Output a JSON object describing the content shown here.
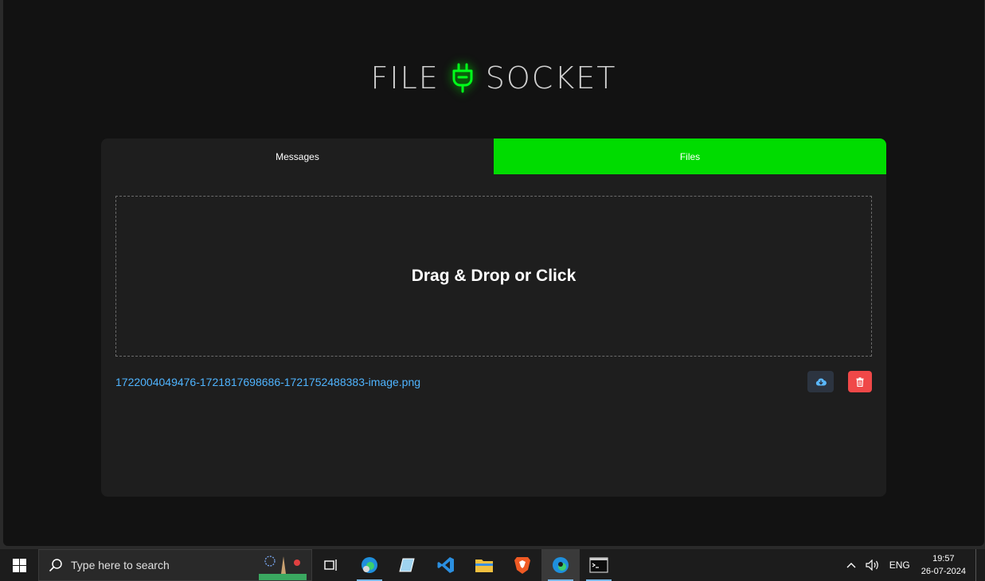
{
  "app": {
    "brand_left": "FILE",
    "brand_right": "SOCKET",
    "brand_icon": "plug-icon",
    "accent_color": "#00dc00"
  },
  "tabs": [
    {
      "label": "Messages",
      "active": false
    },
    {
      "label": "Files",
      "active": true
    }
  ],
  "dropzone": {
    "label": "Drag & Drop or Click"
  },
  "files": [
    {
      "name": "1722004049476-1721817698686-1721752488383-image.png",
      "download_icon": "cloud-download-icon",
      "delete_icon": "trash-icon"
    }
  ],
  "taskbar": {
    "search_placeholder": "Type here to search",
    "language": "ENG",
    "time": "19:57",
    "date": "26-07-2024",
    "apps": [
      "task-view-icon",
      "edge-profile-icon",
      "notepad-icon",
      "vscode-icon",
      "file-explorer-icon",
      "brave-icon",
      "edge-icon",
      "terminal-icon"
    ]
  }
}
